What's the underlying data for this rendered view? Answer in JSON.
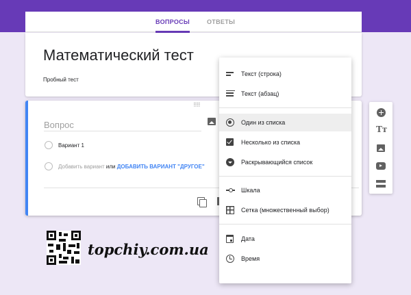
{
  "tabs": [
    {
      "label": "ВОПРОСЫ",
      "active": true
    },
    {
      "label": "ОТВЕТЫ",
      "active": false
    }
  ],
  "form": {
    "title": "Математический тест",
    "description": "Пробный тест"
  },
  "question": {
    "placeholder": "Вопрос",
    "option_1": "Вариант 1",
    "add_option": "Добавить вариант",
    "or": "или",
    "add_other": "ДОБАВИТЬ ВАРИАНТ \"ДРУГОЕ\""
  },
  "menu": {
    "items": [
      {
        "label": "Текст (строка)",
        "icon": "short-text-icon"
      },
      {
        "label": "Текст (абзац)",
        "icon": "paragraph-icon"
      },
      {
        "label": "Один из списка",
        "icon": "radio-icon",
        "selected": true
      },
      {
        "label": "Несколько из списка",
        "icon": "checkbox-icon"
      },
      {
        "label": "Раскрывающийся список",
        "icon": "dropdown-icon"
      },
      {
        "label": "Шкала",
        "icon": "linear-scale-icon"
      },
      {
        "label": "Сетка (множественный выбор)",
        "icon": "grid-icon"
      },
      {
        "label": "Дата",
        "icon": "calendar-icon"
      },
      {
        "label": "Время",
        "icon": "clock-icon"
      }
    ]
  },
  "toolbar": {
    "text_glyph": "Tт"
  },
  "watermark": "topchiy.com.ua",
  "colors": {
    "accent": "#673ab7",
    "link": "#4285f4",
    "background": "#ede7f6"
  }
}
